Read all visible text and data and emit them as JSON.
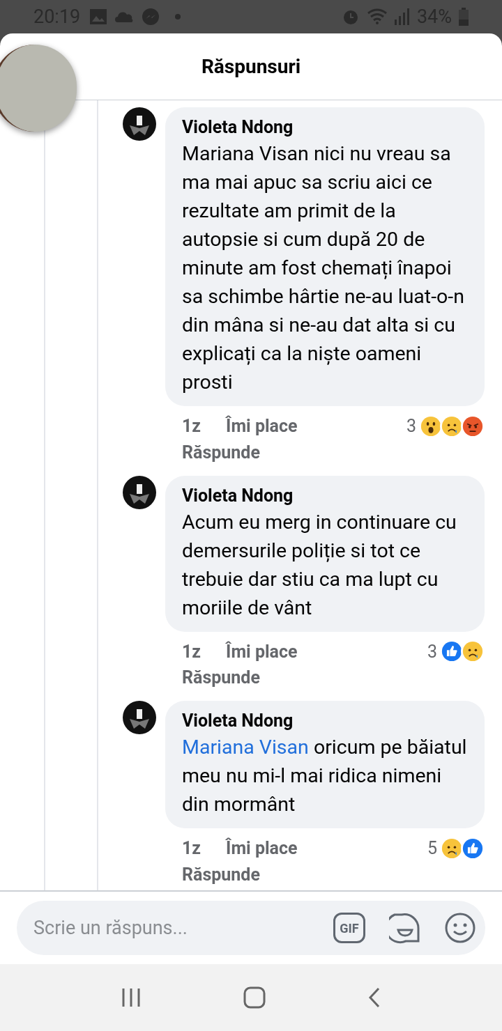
{
  "status_bar": {
    "time": "20:19",
    "battery": "34%"
  },
  "header": {
    "title": "Răspunsuri"
  },
  "comments": [
    {
      "author": "Violeta Ndong",
      "text": "Mariana Visan nici nu vreau sa ma mai apuc sa scriu aici ce rezultate am primit de la autopsie si cum după 20 de minute am fost chemați înapoi sa schimbe hârtie ne-au luat-o-n din mâna si ne-au dat alta si cu explicați ca la niște oameni prosti",
      "time": "1z",
      "like": "Îmi place",
      "reply": "Răspunde",
      "reaction_count": "3",
      "reactions": [
        {
          "kind": "wow"
        },
        {
          "kind": "sad"
        },
        {
          "kind": "angry"
        }
      ]
    },
    {
      "author": "Violeta Ndong",
      "text": "Acum eu merg in continuare cu demersurile poliție si tot ce trebuie dar stiu ca ma lupt cu moriile de vânt",
      "time": "1z",
      "like": "Îmi place",
      "reply": "Răspunde",
      "reaction_count": "3",
      "reactions": [
        {
          "kind": "like"
        },
        {
          "kind": "sad"
        }
      ]
    },
    {
      "author": "Violeta Ndong",
      "mention": "Mariana Visan",
      "text": "oricum pe băiatul meu nu mi-l mai ridica nimeni din mormânt",
      "time": "1z",
      "like": "Îmi place",
      "reply": "Răspunde",
      "reaction_count": "5",
      "reactions": [
        {
          "kind": "sad"
        },
        {
          "kind": "like"
        }
      ]
    }
  ],
  "composer": {
    "placeholder": "Scrie un răspuns...",
    "gif_label": "GIF"
  }
}
